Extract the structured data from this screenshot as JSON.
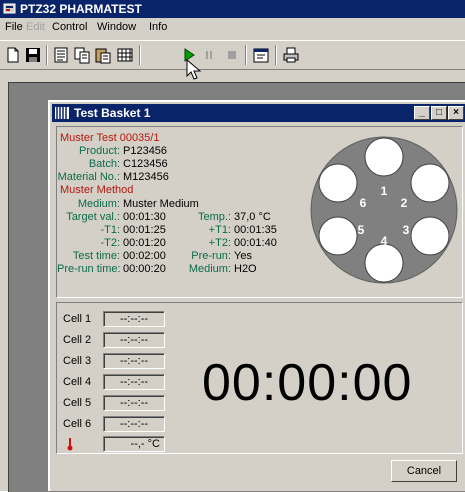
{
  "app": {
    "title": "PTZ32 PHARMATEST"
  },
  "menu": [
    "File",
    "Edit",
    "Control",
    "Window",
    "Info"
  ],
  "toolbar": {
    "icons": [
      "new-icon",
      "save-icon",
      "doc-icon",
      "copy-icon",
      "paste-icon",
      "grid-icon",
      "play-icon",
      "pause-icon",
      "stop-icon",
      "properties-icon",
      "print-icon"
    ]
  },
  "child": {
    "title": "Test Basket 1",
    "controls": {
      "minimize": "_",
      "maximize": "□",
      "close": "×"
    }
  },
  "info": {
    "test_heading": "Muster Test 00035/1",
    "product_label": "Product:",
    "product": "P123456",
    "batch_label": "Batch:",
    "batch": "C123456",
    "material_label": "Material No.:",
    "material": "M123456",
    "method_heading": "Muster Method",
    "medium_label": "Medium:",
    "medium": "Muster Medium",
    "target_label": "Target val.:",
    "target": "00:01:30",
    "temp_label": "Temp.:",
    "temp": "37,0 °C",
    "t1m_label": "-T1:",
    "t1m": "00:01:25",
    "t1p_label": "+T1:",
    "t1p": "00:01:35",
    "t2m_label": "-T2:",
    "t2m": "00:01:20",
    "t2p_label": "+T2:",
    "t2p": "00:01:40",
    "testtime_label": "Test time:",
    "testtime": "00:02:00",
    "prerun_label": "Pre-run:",
    "prerun": "Yes",
    "preruntime_label": "Pre-run time:",
    "preruntime": "00:00:20",
    "medium2_label": "Medium:",
    "medium2": "H2O"
  },
  "disc": {
    "positions": [
      "1",
      "2",
      "3",
      "4",
      "5",
      "6"
    ]
  },
  "cells": [
    {
      "label": "Cell 1",
      "value": "--:--:--"
    },
    {
      "label": "Cell 2",
      "value": "--:--:--"
    },
    {
      "label": "Cell 3",
      "value": "--:--:--"
    },
    {
      "label": "Cell 4",
      "value": "--:--:--"
    },
    {
      "label": "Cell 5",
      "value": "--:--:--"
    },
    {
      "label": "Cell 6",
      "value": "--:--:--"
    }
  ],
  "temperature": {
    "value": "--,- °C"
  },
  "timer": "00:00:00",
  "buttons": {
    "cancel": "Cancel"
  },
  "colors": {
    "title_bar": "#0a246a",
    "label_green": "#0a6b4a",
    "heading_red": "#b3180c",
    "face": "#d4d0c8"
  }
}
